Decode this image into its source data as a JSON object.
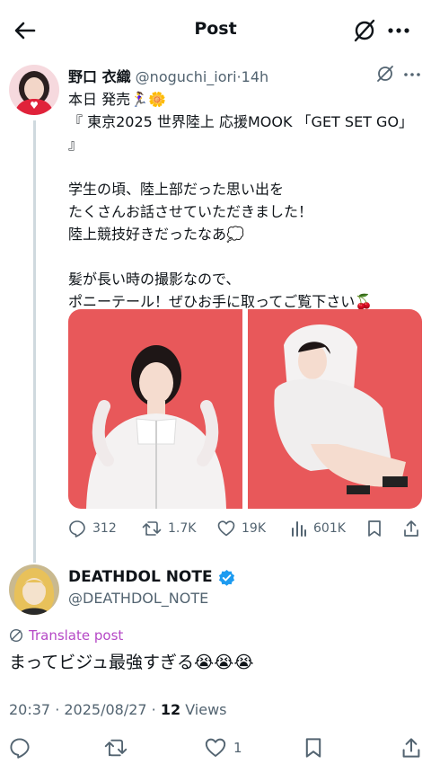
{
  "header": {
    "title": "Post"
  },
  "quoted_post": {
    "author_name": "野口 衣織",
    "handle": "@noguchi_iori",
    "separator": "·",
    "time": "14h",
    "text": "本日 発売🏃‍♀️🌼\n『 東京2025 世界陸上 応援MOOK 「GET SET GO」 』\n\n学生の頃、陸上部だった思い出を\nたくさんお話させていただきました！\n陸上競技好きだったなあ💭\n\n髪が長い時の撮影なので、\nポニーテール！ぜひお手に取ってご覧下さい🍒",
    "stats": {
      "replies": "312",
      "reposts": "1.7K",
      "likes": "19K",
      "views": "601K"
    }
  },
  "main_post": {
    "author_name": "DEATHDOL NOTE",
    "handle": "@DEATHDOL_NOTE",
    "translate_label": "Translate post",
    "text": "まってビジュ最強すぎる😭😭😭",
    "timestamp": "20:37 · 2025/08/27 · ",
    "views_count": "12",
    "views_label": " Views",
    "likes": "1"
  },
  "colors": {
    "verified": "#1d9bf0",
    "translate": "#b548c6",
    "photo_bg": "#e8585a"
  }
}
